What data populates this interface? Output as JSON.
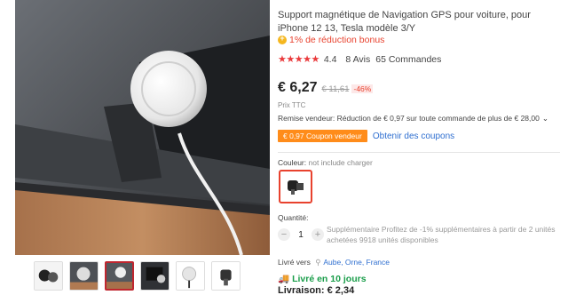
{
  "product": {
    "title": "Support magnétique de Navigation GPS pour voiture, pour iPhone 12 13, Tesla modèle 3/Y",
    "bonus": "1% de réduction bonus",
    "rating": "4.4",
    "reviews": "8 Avis",
    "orders": "65 Commandes",
    "stars": "★★★★★"
  },
  "pricing": {
    "price": "€ 6,27",
    "old_price": "€ 11,61",
    "discount": "-46%",
    "tax_note": "Prix TTC",
    "seller_discount": "Remise vendeur: Réduction de € 0,97 sur toute commande de plus de € 28,00",
    "coupon": "€ 0,97 Coupon vendeur",
    "coupon_link": "Obtenir des coupons"
  },
  "variant": {
    "color_label": "Couleur:",
    "color_value": "not include charger"
  },
  "quantity": {
    "label": "Quantité:",
    "value": "1",
    "minus": "−",
    "plus": "+",
    "info": "Supplémentaire Profitez de -1% supplémentaires à partir de 2 unités achetées 9918 unités disponibles"
  },
  "shipping": {
    "ship_to_label": "Livré vers",
    "location": "Aube, Orne, France",
    "delivery": "Livré en 10 jours",
    "cost": "Livraison: € 2,34"
  },
  "icons": {
    "bonus": "coin-icon",
    "pin": "location-pin-icon",
    "truck": "truck-icon",
    "chevron": "chevron-down-icon"
  },
  "colors": {
    "accent": "#e8422e",
    "coupon": "#ff8c1a",
    "link": "#2f6fd0",
    "delivery": "#1b9e4b"
  }
}
